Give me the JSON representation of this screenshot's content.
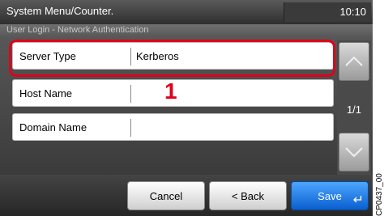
{
  "header": {
    "title": "System Menu/Counter.",
    "clock": "10:10",
    "subtitle": "User Login - Network Authentication"
  },
  "settings": [
    {
      "label": "Server Type",
      "value": "Kerberos"
    },
    {
      "label": "Host Name",
      "value": ""
    },
    {
      "label": "Domain Name",
      "value": ""
    }
  ],
  "scroll": {
    "page": "1/1"
  },
  "callout": "1",
  "buttons": {
    "cancel": "Cancel",
    "back": "< Back",
    "save": "Save"
  },
  "figure_code": "CP0437_00",
  "colors": {
    "highlight": "#e0001a",
    "save_button": "#1a73e8"
  }
}
